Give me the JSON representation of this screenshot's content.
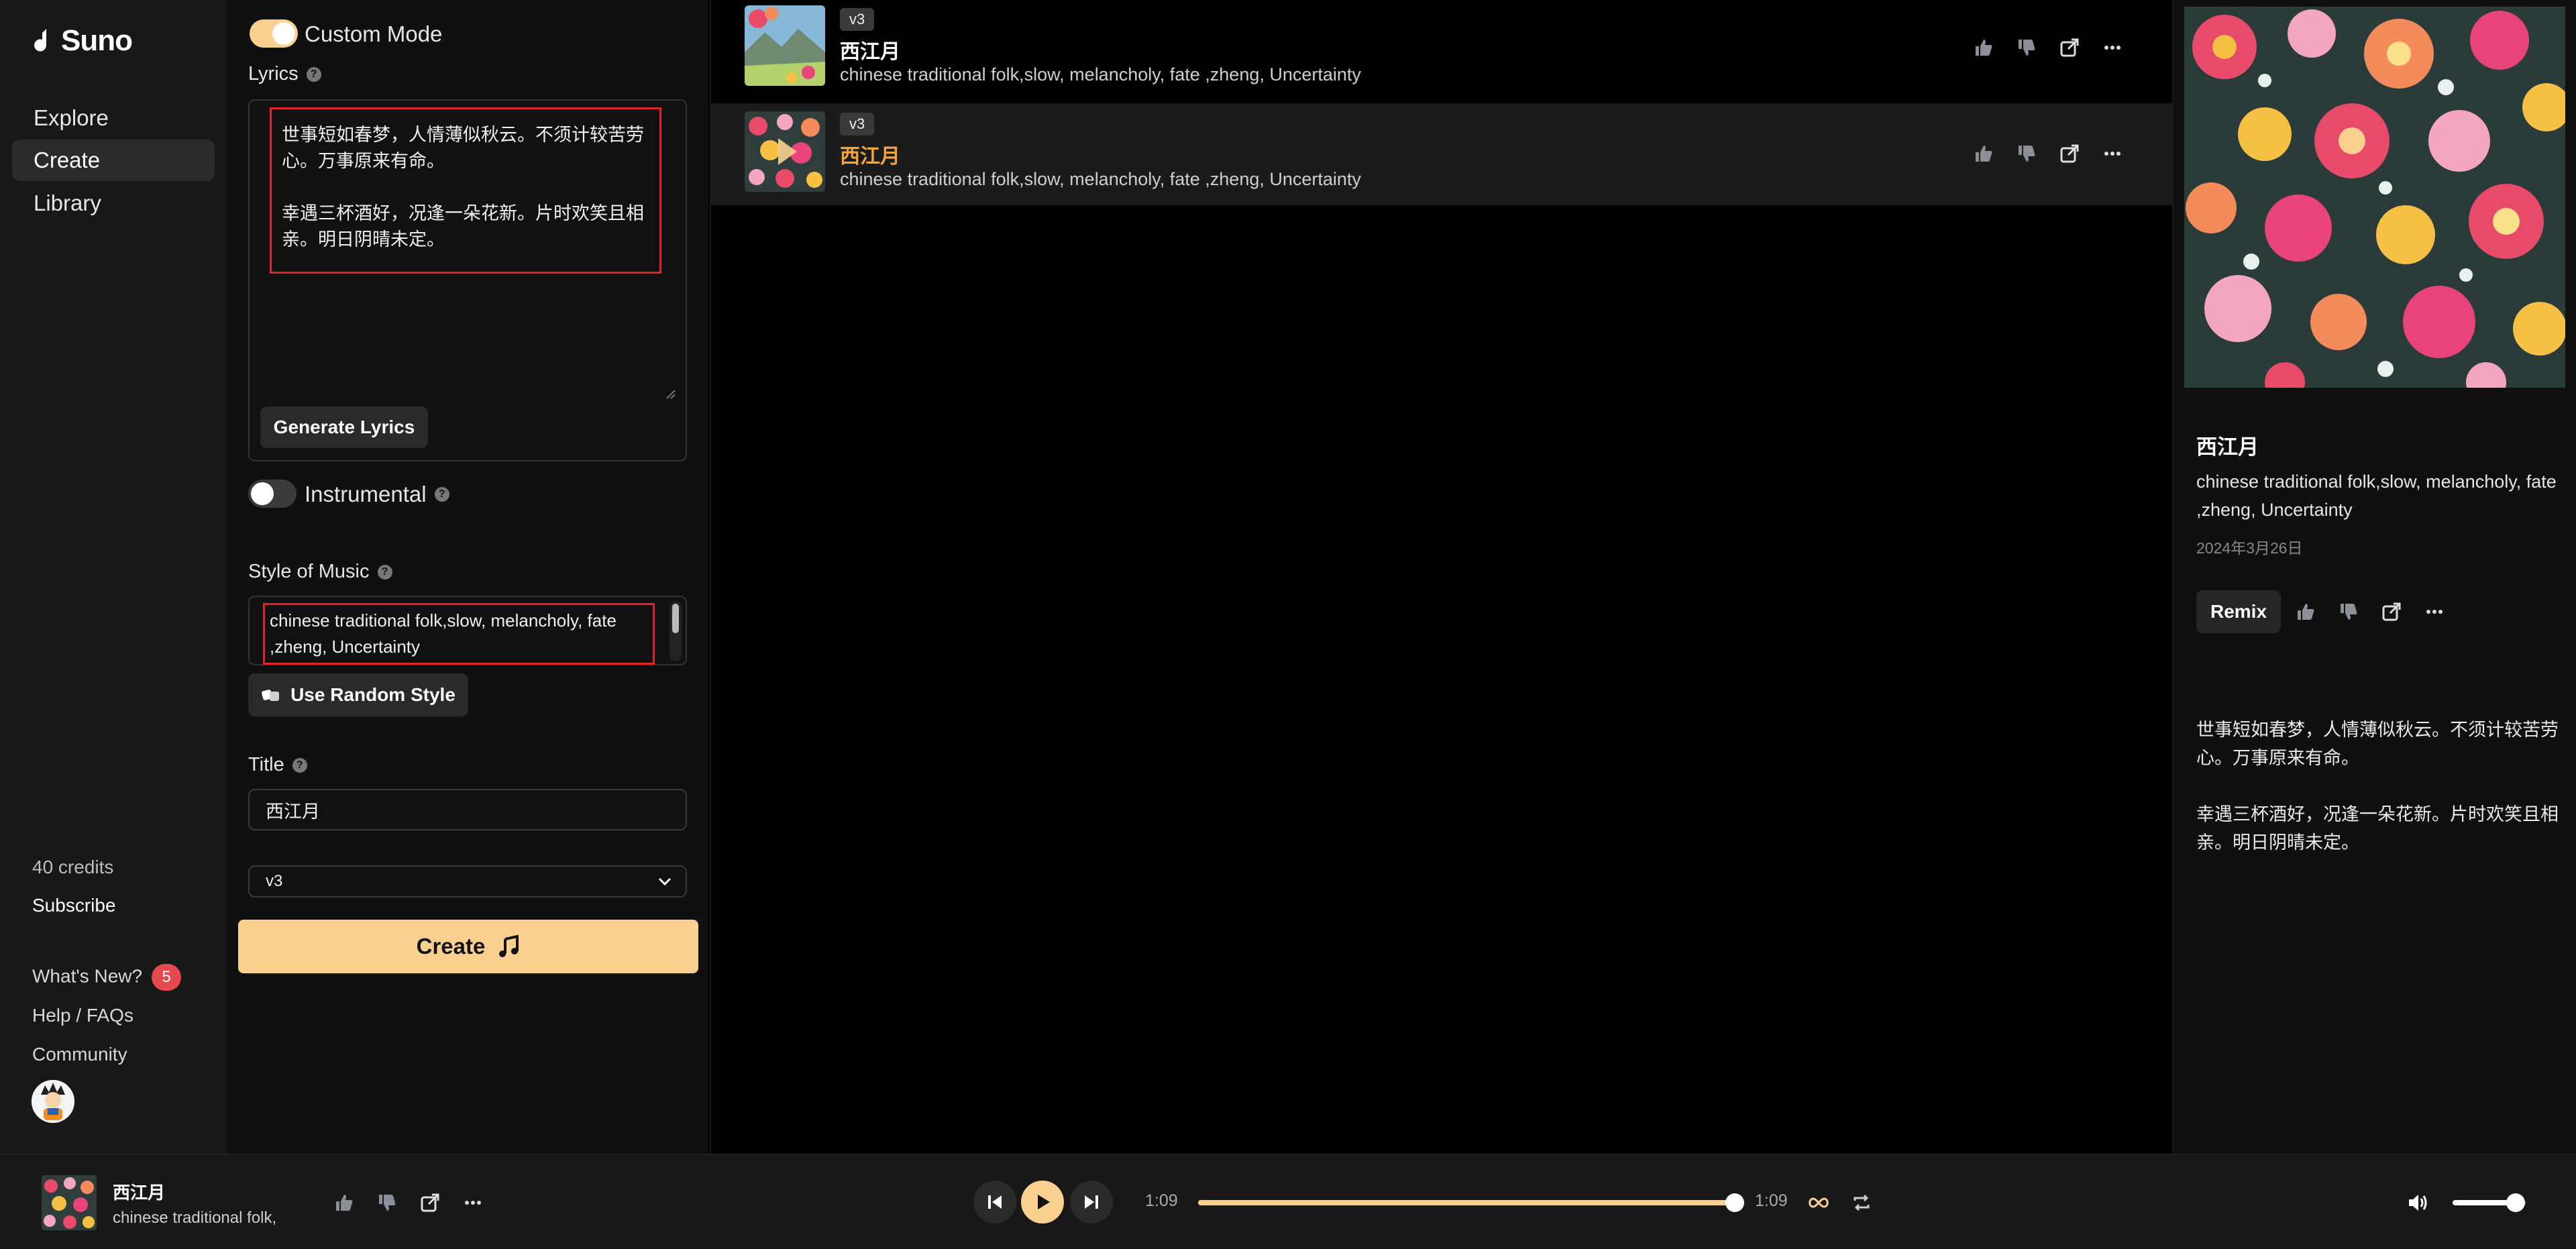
{
  "app": {
    "brand": "Suno"
  },
  "sidebar": {
    "nav": [
      {
        "label": "Explore"
      },
      {
        "label": "Create",
        "active": true
      },
      {
        "label": "Library"
      }
    ],
    "credits": "40 credits",
    "subscribe": "Subscribe",
    "whats_new": "What's New?",
    "whats_new_badge": "5",
    "help": "Help / FAQs",
    "community": "Community"
  },
  "create": {
    "custom_mode_label": "Custom Mode",
    "custom_mode_on": true,
    "lyrics_label": "Lyrics",
    "lyrics_value": "世事短如春梦，人情薄似秋云。不须计较苦劳心。万事原来有命。\n\n幸遇三杯酒好，况逢一朵花新。片时欢笑且相亲。明日阴晴未定。",
    "generate_lyrics": "Generate Lyrics",
    "instrumental_label": "Instrumental",
    "instrumental_on": false,
    "style_label": "Style of Music",
    "style_value": "chinese traditional folk,slow, melancholy, fate ,zheng, Uncertainty",
    "random_style": "Use Random Style",
    "title_label": "Title",
    "title_value": "西江月",
    "model_value": "v3",
    "create_button": "Create"
  },
  "songs": [
    {
      "version": "v3",
      "title": "西江月",
      "tags": "chinese traditional folk,slow, melancholy, fate ,zheng, Uncertainty",
      "active": false
    },
    {
      "version": "v3",
      "title": "西江月",
      "tags": "chinese traditional folk,slow, melancholy, fate ,zheng, Uncertainty",
      "active": true
    }
  ],
  "detail": {
    "title": "西江月",
    "tags": "chinese traditional folk,slow, melancholy, fate ,zheng, Uncertainty",
    "date": "2024年3月26日",
    "remix": "Remix",
    "lyrics": "世事短如春梦，人情薄似秋云。不须计较苦劳心。万事原来有命。\n\n幸遇三杯酒好，况逢一朵花新。片时欢笑且相亲。明日阴晴未定。"
  },
  "player": {
    "title": "西江月",
    "subtitle": "chinese traditional folk,",
    "elapsed": "1:09",
    "duration": "1:09",
    "progress": 1.0,
    "volume": 0.85
  },
  "colors": {
    "accent": "#f9d08e",
    "highlight_title": "#f6a33a",
    "annotation_red": "#e0242a",
    "badge": "#e5484d"
  }
}
